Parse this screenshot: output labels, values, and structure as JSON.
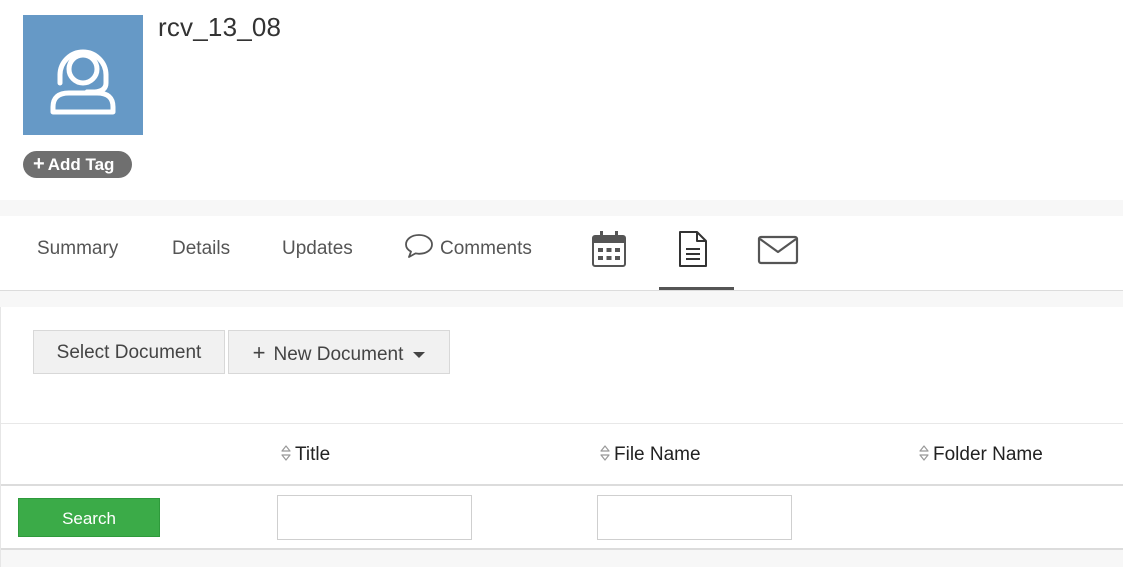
{
  "record": {
    "name": "rcv_13_08",
    "avatar_icon": "headset-user-icon",
    "avatar_color": "#6699c6",
    "add_tag_label": "Add Tag"
  },
  "tabs": {
    "summary": "Summary",
    "details": "Details",
    "updates": "Updates",
    "comments": "Comments",
    "icons": [
      "comment-icon",
      "calendar-icon",
      "document-icon",
      "email-icon"
    ],
    "active": "document-icon"
  },
  "documents": {
    "select_button": "Select Document",
    "new_button": "New Document",
    "columns": [
      "Title",
      "File Name",
      "Folder Name"
    ],
    "search_button": "Search",
    "search_color": "#3bab48",
    "title_filter_value": "",
    "file_filter_value": ""
  }
}
